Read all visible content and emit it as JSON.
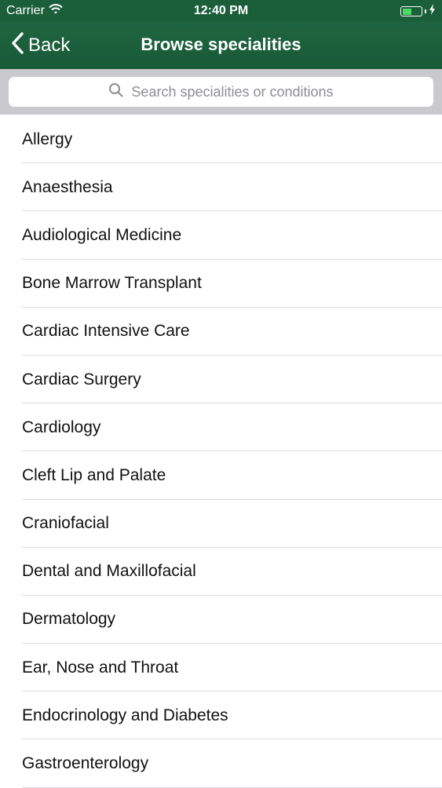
{
  "status_bar": {
    "carrier": "Carrier",
    "time": "12:40 PM",
    "battery_level": 0.5
  },
  "nav_bar": {
    "back_label": "Back",
    "title": "Browse specialities"
  },
  "search": {
    "placeholder": "Search specialities or conditions"
  },
  "specialities": [
    "Allergy",
    "Anaesthesia",
    "Audiological Medicine",
    "Bone Marrow Transplant",
    "Cardiac Intensive Care",
    "Cardiac Surgery",
    "Cardiology",
    "Cleft Lip and Palate",
    "Craniofacial",
    "Dental and Maxillofacial",
    "Dermatology",
    "Ear, Nose and Throat",
    "Endocrinology and Diabetes",
    "Gastroenterology"
  ],
  "colors": {
    "nav_background": "#1b5e3a",
    "battery": "#4cd964",
    "search_background": "#c9c9ce"
  }
}
